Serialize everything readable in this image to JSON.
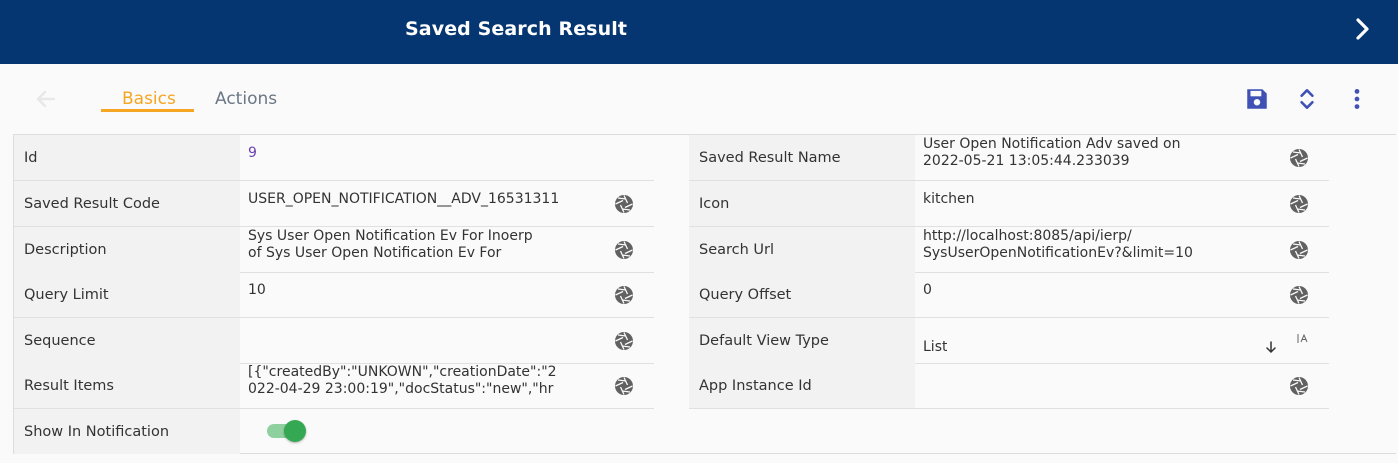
{
  "header": {
    "title": "Saved Search Result"
  },
  "tabs": [
    {
      "label": "Basics",
      "active": true
    },
    {
      "label": "Actions",
      "active": false
    }
  ],
  "colors": {
    "header_bg": "#063671",
    "accent": "#f5a623",
    "icon_blue": "#3f51b5",
    "toggle_on": "#34a853"
  },
  "left_fields": [
    {
      "label": "Id",
      "value": "9"
    },
    {
      "label": "Saved Result Code",
      "value": "USER_OPEN_NOTIFICATION__ADV_16531311"
    },
    {
      "label": "Description",
      "value_line1": "Sys User Open Notification Ev  For Inoerp",
      "value_line2": "of Sys User Open Notification Ev  For"
    },
    {
      "label": "Query Limit",
      "value": "10"
    },
    {
      "label": "Sequence",
      "value": ""
    },
    {
      "label": "Result Items",
      "value_line1": "[{\"createdBy\":\"UNKOWN\",\"creationDate\":\"2",
      "value_line2": "022-04-29 23:00:19\",\"docStatus\":\"new\",\"hr"
    },
    {
      "label": "Show In Notification",
      "value": true
    }
  ],
  "right_fields": [
    {
      "label": "Saved Result Name",
      "value_line1": "User Open Notification  Adv saved on",
      "value_line2": "2022-05-21 13:05:44.233039"
    },
    {
      "label": "Icon",
      "value": "kitchen"
    },
    {
      "label": "Search Url",
      "value_line1": "http://localhost:8085/api/ierp/",
      "value_line2": "SysUserOpenNotificationEv?&limit=10"
    },
    {
      "label": "Query Offset",
      "value": "0"
    },
    {
      "label": "Default View Type",
      "value": "List"
    },
    {
      "label": "App Instance Id",
      "value": ""
    }
  ]
}
